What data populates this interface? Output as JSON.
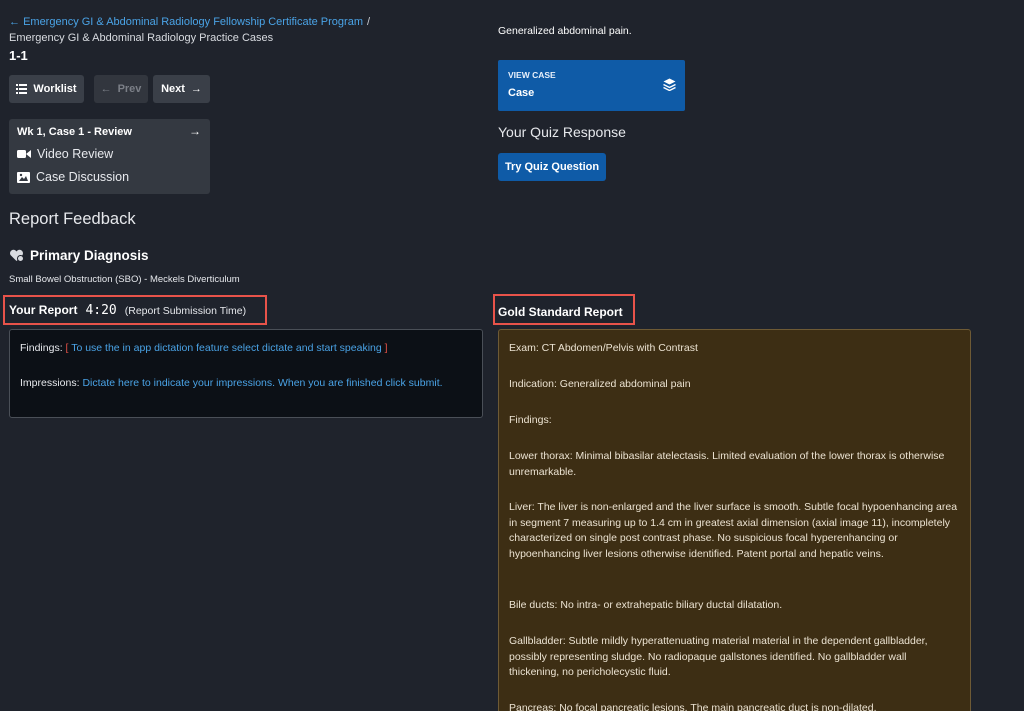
{
  "breadcrumb": {
    "back_arrow": "←",
    "link": "Emergency GI & Abdominal Radiology Fellowship Certificate Program",
    "separator": "/",
    "sub": "Emergency GI & Abdominal Radiology Practice Cases"
  },
  "case_number": "1-1",
  "toolbar": {
    "worklist_label": "Worklist",
    "prev_label": "Prev",
    "next_label": "Next"
  },
  "case_box": {
    "title": "Wk 1, Case 1 - Review",
    "video_review": "Video Review",
    "case_discussion": "Case Discussion"
  },
  "report_feedback_title": "Report Feedback",
  "primary_diagnosis": {
    "title": "Primary Diagnosis",
    "value": "Small Bowel Obstruction (SBO) - Meckels Diverticulum"
  },
  "your_report": {
    "label": "Your Report",
    "time": "4:20",
    "time_note": "(Report Submission Time)",
    "findings_label": "Findings:",
    "findings_open": "[",
    "findings_hint": "To use the in app dictation feature select dictate and start speaking",
    "findings_close": "]",
    "impressions_label": "Impressions:",
    "impressions_hint": "Dictate here to indicate your impressions.  When you are finished click submit."
  },
  "history": "Generalized abdominal pain.",
  "view_case": {
    "small_label": "VIEW CASE",
    "label": "Case"
  },
  "quiz": {
    "title": "Your Quiz Response",
    "button_label": "Try Quiz Question"
  },
  "gold_standard": {
    "title": "Gold Standard Report",
    "paragraphs": [
      "Exam: CT Abdomen/Pelvis with Contrast",
      "Indication: Generalized abdominal pain",
      "Findings:",
      "Lower thorax: Minimal bibasilar atelectasis. Limited evaluation of the lower thorax is otherwise unremarkable.",
      "Liver: The liver is non-enlarged and the liver surface is smooth. Subtle focal hypoenhancing area in segment 7 measuring up to 1.4 cm in greatest axial dimension (axial image 11), incompletely characterized on single post contrast phase. No suspicious focal hyperenhancing or hypoenhancing liver lesions otherwise identified. Patent portal and hepatic veins.",
      "Bile ducts: No intra- or extrahepatic biliary ductal dilatation.",
      "Gallbladder: Subtle mildly hyperattenuating material material in the dependent gallbladder, possibly representing sludge. No radiopaque gallstones identified. No gallbladder wall thickening, no pericholecystic fluid.",
      "Pancreas: No focal pancreatic lesions. The main pancreatic duct is non-dilated."
    ]
  },
  "colors": {
    "background": "#1f232c",
    "link": "#4aa3e6",
    "primary_button": "#0f5ba7",
    "highlight_border": "#e8534a",
    "gold_report_bg": "#3d2e14"
  }
}
